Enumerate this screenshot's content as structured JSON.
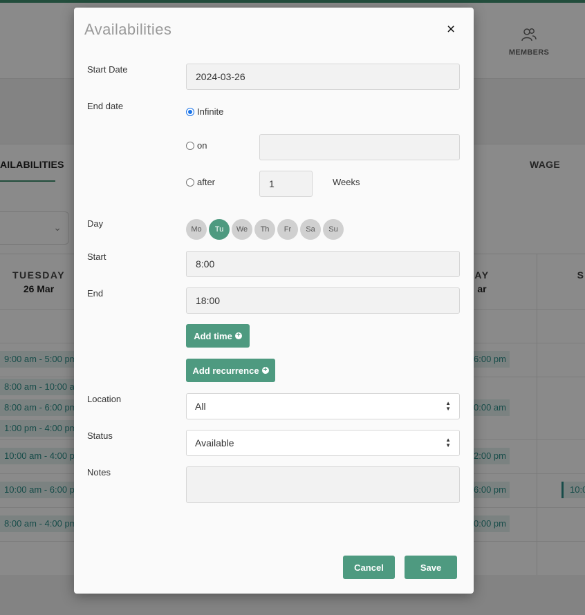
{
  "background": {
    "members_label": "MEMBERS",
    "tabs": {
      "availabilities": "AILABILITIES",
      "wage": "WAGE"
    },
    "columns": [
      {
        "day": "TUESDAY",
        "date": "26 Mar"
      },
      {
        "day": "AY",
        "date": "ar"
      },
      {
        "day": "S",
        "date": ""
      }
    ],
    "left_slots": [
      "9:00 am - 5:00 pm",
      "8:00 am - 10:00 am",
      "8:00 am - 6:00 pm",
      "1:00 pm - 4:00 pm",
      "10:00 am - 4:00 pm",
      "10:00 am - 6:00 pm",
      "8:00 am - 4:00 pm"
    ],
    "right_slots": [
      "6:00 pm",
      "0:00 am",
      "2:00 pm",
      "6:00 pm",
      "0:00 pm"
    ],
    "far_right_slot": "10:0"
  },
  "modal": {
    "title": "Availabilities",
    "close_symbol": "×",
    "start_date_label": "Start Date",
    "start_date_value": "2024-03-26",
    "end_date_label": "End date",
    "end_options": {
      "infinite": "Infinite",
      "on": "on",
      "after": "after"
    },
    "on_value": "",
    "after_value": "1",
    "after_unit": "Weeks",
    "day_label": "Day",
    "days": [
      "Mo",
      "Tu",
      "We",
      "Th",
      "Fr",
      "Sa",
      "Su"
    ],
    "selected_day": "Tu",
    "start_label": "Start",
    "start_value": "8:00",
    "end_label": "End",
    "end_value": "18:00",
    "add_time_label": "Add time",
    "add_recurrence_label": "Add recurrence",
    "location_label": "Location",
    "location_value": "All",
    "status_label": "Status",
    "status_value": "Available",
    "notes_label": "Notes",
    "notes_value": "",
    "cancel_label": "Cancel",
    "save_label": "Save"
  },
  "colors": {
    "accent": "#4e9a80",
    "radio_checked": "#1a73e8",
    "slot_text": "#2b8c88"
  }
}
